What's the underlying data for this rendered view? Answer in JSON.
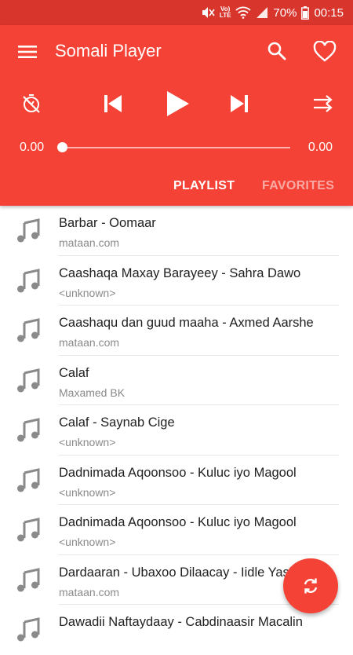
{
  "status_bar": {
    "battery_percent": "70%",
    "time": "00:15",
    "network_label": "Vo) LTE",
    "icons": [
      "mute-icon",
      "lte-icon",
      "wifi-icon",
      "signal-icon",
      "battery-icon"
    ]
  },
  "app": {
    "title": "Somali Player",
    "accent_color": "#f44336",
    "status_color": "#d8352d"
  },
  "player": {
    "current_time": "0.00",
    "total_time": "0.00",
    "progress": 0
  },
  "tabs": [
    {
      "label": "PLAYLIST",
      "active": true
    },
    {
      "label": "FAVORITES",
      "active": false
    }
  ],
  "playlist": [
    {
      "title": "Barbar - Oomaar",
      "artist": "mataan.com"
    },
    {
      "title": "Caashaqa Maxay Barayeey - Sahra Dawo",
      "artist": "<unknown>"
    },
    {
      "title": "Caashaqu dan guud maaha - Axmed Aarshe",
      "artist": "mataan.com"
    },
    {
      "title": "Calaf",
      "artist": "Maxamed BK"
    },
    {
      "title": "Calaf - Saynab Cige",
      "artist": "<unknown>"
    },
    {
      "title": "Dadnimada Aqoonsoo - Kuluc iyo Magool",
      "artist": "<unknown>"
    },
    {
      "title": "Dadnimada Aqoonsoo - Kuluc iyo Magool",
      "artist": "<unknown>"
    },
    {
      "title": "Dardaaran - Ubaxoo Dilaacay - Iidle Yasiin",
      "artist": "mataan.com"
    },
    {
      "title": "Dawadii Naftaydaay - Cabdinaasir Macalin",
      "artist": ""
    }
  ]
}
